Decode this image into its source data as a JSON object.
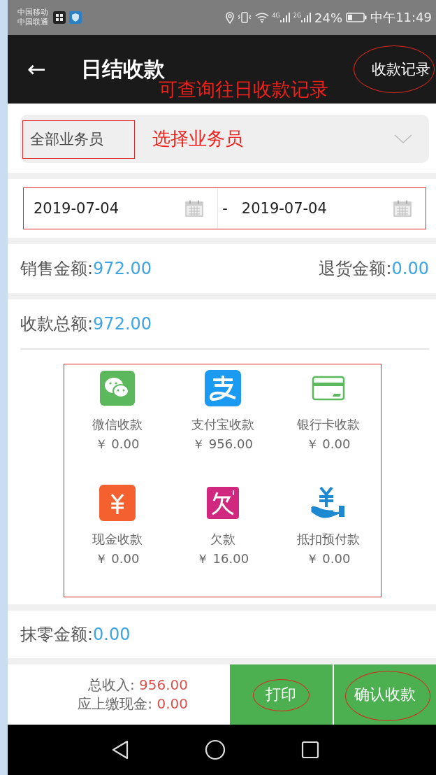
{
  "status_bar": {
    "carriers": [
      "中国移动",
      "中国联通"
    ],
    "network_labels": [
      "4G",
      "2G"
    ],
    "battery": "24%",
    "time": "中午11:49"
  },
  "header": {
    "back": "←",
    "title": "日结收款",
    "action": "收款记录",
    "note": "可查询往日收款记录"
  },
  "salesperson": {
    "value": "全部业务员",
    "note": "选择业务员"
  },
  "date_range": {
    "start": "2019-07-04",
    "separator": "-",
    "end": "2019-07-04"
  },
  "sales": {
    "label": "销售金额:",
    "value": "972.00",
    "returns_label": "退货金额:",
    "returns_value": "0.00"
  },
  "collection": {
    "label": "收款总额:",
    "value": "972.00",
    "methods": [
      {
        "kind": "wechat",
        "label": "微信收款",
        "amount": "￥ 0.00"
      },
      {
        "kind": "alipay",
        "label": "支付宝收款",
        "amount": "￥ 956.00"
      },
      {
        "kind": "card",
        "label": "银行卡收款",
        "amount": "￥ 0.00"
      },
      {
        "kind": "cash",
        "label": "现金收款",
        "amount": "￥ 0.00"
      },
      {
        "kind": "debt",
        "label": "欠款",
        "amount": "￥ 16.00"
      },
      {
        "kind": "prepaid",
        "label": "抵扣预付款",
        "amount": "￥ 0.00"
      }
    ]
  },
  "rounding": {
    "label": "抹零金额:",
    "value": "0.00"
  },
  "footer": {
    "income_label": "总收入:",
    "income_value": "956.00",
    "cash_label": "应上缴现金:",
    "cash_value": "0.00",
    "buttons": [
      "打印",
      "确认收款"
    ]
  }
}
